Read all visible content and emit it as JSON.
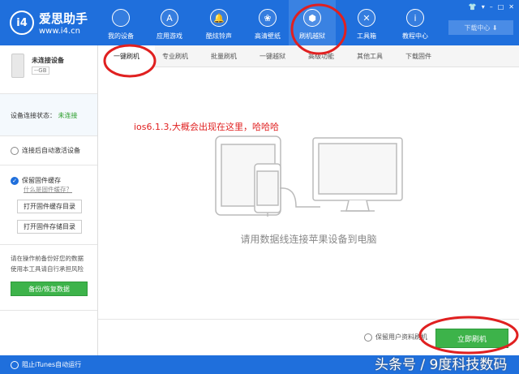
{
  "app": {
    "name": "爱思助手",
    "url": "www.i4.cn",
    "logo_text": "i4"
  },
  "nav": [
    {
      "label": "我的设备",
      "icon": ""
    },
    {
      "label": "应用游戏",
      "icon": "A"
    },
    {
      "label": "酷炫铃声",
      "icon": "🔔"
    },
    {
      "label": "高清壁纸",
      "icon": "❀"
    },
    {
      "label": "刷机越狱",
      "icon": "⬢"
    },
    {
      "label": "工具箱",
      "icon": "✕"
    },
    {
      "label": "教程中心",
      "icon": "i"
    }
  ],
  "window_controls": [
    "👕",
    "▾",
    "–",
    "□",
    "✕"
  ],
  "download_center": "下载中心 ⬇",
  "device": {
    "name": "未连接设备",
    "capacity": "--GB"
  },
  "sidebar": {
    "status_label": "设备连接状态：",
    "status_value": "未连接",
    "auto_activate": "连接后自动激活设备",
    "keep_cache": "保留固件缓存",
    "cache_help": "什么是固件缓存？",
    "open_cache_dir": "打开固件缓存目录",
    "open_storage_dir": "打开固件存储目录",
    "warning1": "请在操作前备份好您的数据",
    "warning2": "使用本工具请自行承担风险",
    "backup_button": "备份/恢复数据"
  },
  "tabs": [
    "一键刷机",
    "专业刷机",
    "批量刷机",
    "一键越狱",
    "高级功能",
    "其他工具",
    "下载固件"
  ],
  "main": {
    "annotation": "ios6.1.3,大概会出现在这里，哈哈哈",
    "connect_prompt": "请用数据线连接苹果设备到电脑",
    "keep_user_data": "保留用户资料刷机",
    "flash_button": "立即刷机"
  },
  "statusbar": {
    "itunes": "阻止iTunes自动运行"
  },
  "watermark": "头条号 / 9度科技数码",
  "colors": {
    "brand": "#1f6fdc",
    "green": "#3db34a",
    "annotation": "#e02020"
  }
}
